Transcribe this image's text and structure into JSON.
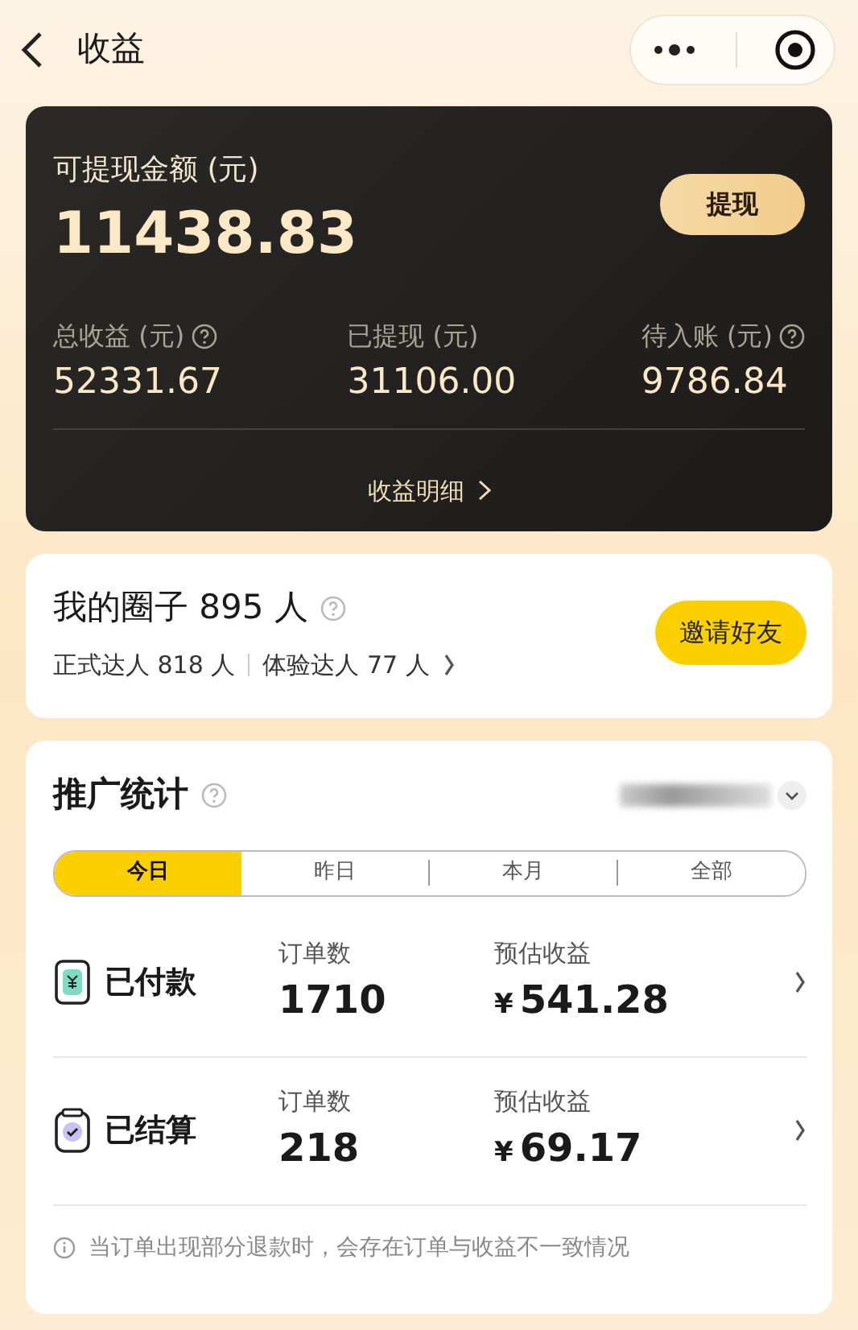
{
  "header": {
    "title": "收益"
  },
  "balance": {
    "label": "可提现金额 (元)",
    "amount": "11438.83",
    "withdraw_button": "提现",
    "detail_link": "收益明细",
    "stats": [
      {
        "label": "总收益 (元)",
        "value": "52331.67",
        "help": true
      },
      {
        "label": "已提现 (元)",
        "value": "31106.00",
        "help": false
      },
      {
        "label": "待入账 (元)",
        "value": "9786.84",
        "help": true
      }
    ]
  },
  "circle": {
    "title": "我的圈子 895 人",
    "help": true,
    "counts": [
      "正式达人 818 人",
      "体验达人 77 人"
    ],
    "invite_button": "邀请好友"
  },
  "promo": {
    "title": "推广统计",
    "help": true,
    "tabs": [
      {
        "label": "今日",
        "selected": true
      },
      {
        "label": "昨日",
        "selected": false
      },
      {
        "label": "本月",
        "selected": false
      },
      {
        "label": "全部",
        "selected": false
      }
    ],
    "rows": [
      {
        "kind": "paid",
        "label": "已付款",
        "orders_label": "订单数",
        "orders": "1710",
        "income_label": "预估收益",
        "currency": "¥",
        "income": "541.28"
      },
      {
        "kind": "settled",
        "label": "已结算",
        "orders_label": "订单数",
        "orders": "218",
        "income_label": "预估收益",
        "currency": "¥",
        "income": "69.17"
      }
    ],
    "note": "当订单出现部分退款时，会存在订单与收益不一致情况"
  }
}
